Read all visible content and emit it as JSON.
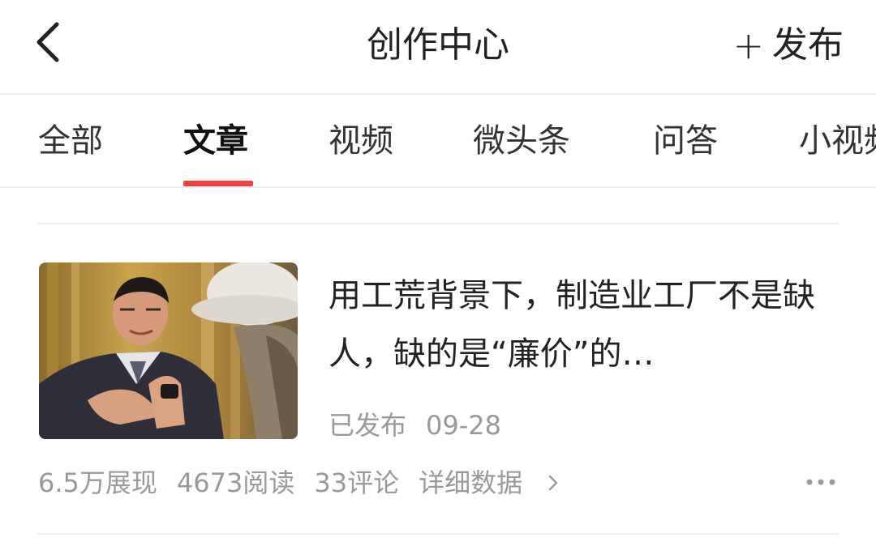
{
  "header": {
    "title": "创作中心",
    "publish_label": "发布",
    "back_icon": "chevron-left-icon",
    "plus_icon": "plus-icon"
  },
  "tabs": [
    {
      "label": "全部",
      "active": false
    },
    {
      "label": "文章",
      "active": true
    },
    {
      "label": "视频",
      "active": false
    },
    {
      "label": "微头条",
      "active": false
    },
    {
      "label": "问答",
      "active": false
    },
    {
      "label": "小视频",
      "active": false
    }
  ],
  "colors": {
    "accent": "#f04142",
    "text_primary": "#222222",
    "text_secondary": "#999999"
  },
  "article": {
    "title": "用工荒背景下，制造业工厂不是缺人，缺的是“廉价”的…",
    "status": "已发布",
    "date": "09-28",
    "stats": {
      "impressions": "6.5万展现",
      "reads": "4673阅读",
      "comments": "33评论",
      "details_label": "详细数据"
    },
    "more_icon": "more-horizontal-icon",
    "details_icon": "chevron-right-icon"
  }
}
